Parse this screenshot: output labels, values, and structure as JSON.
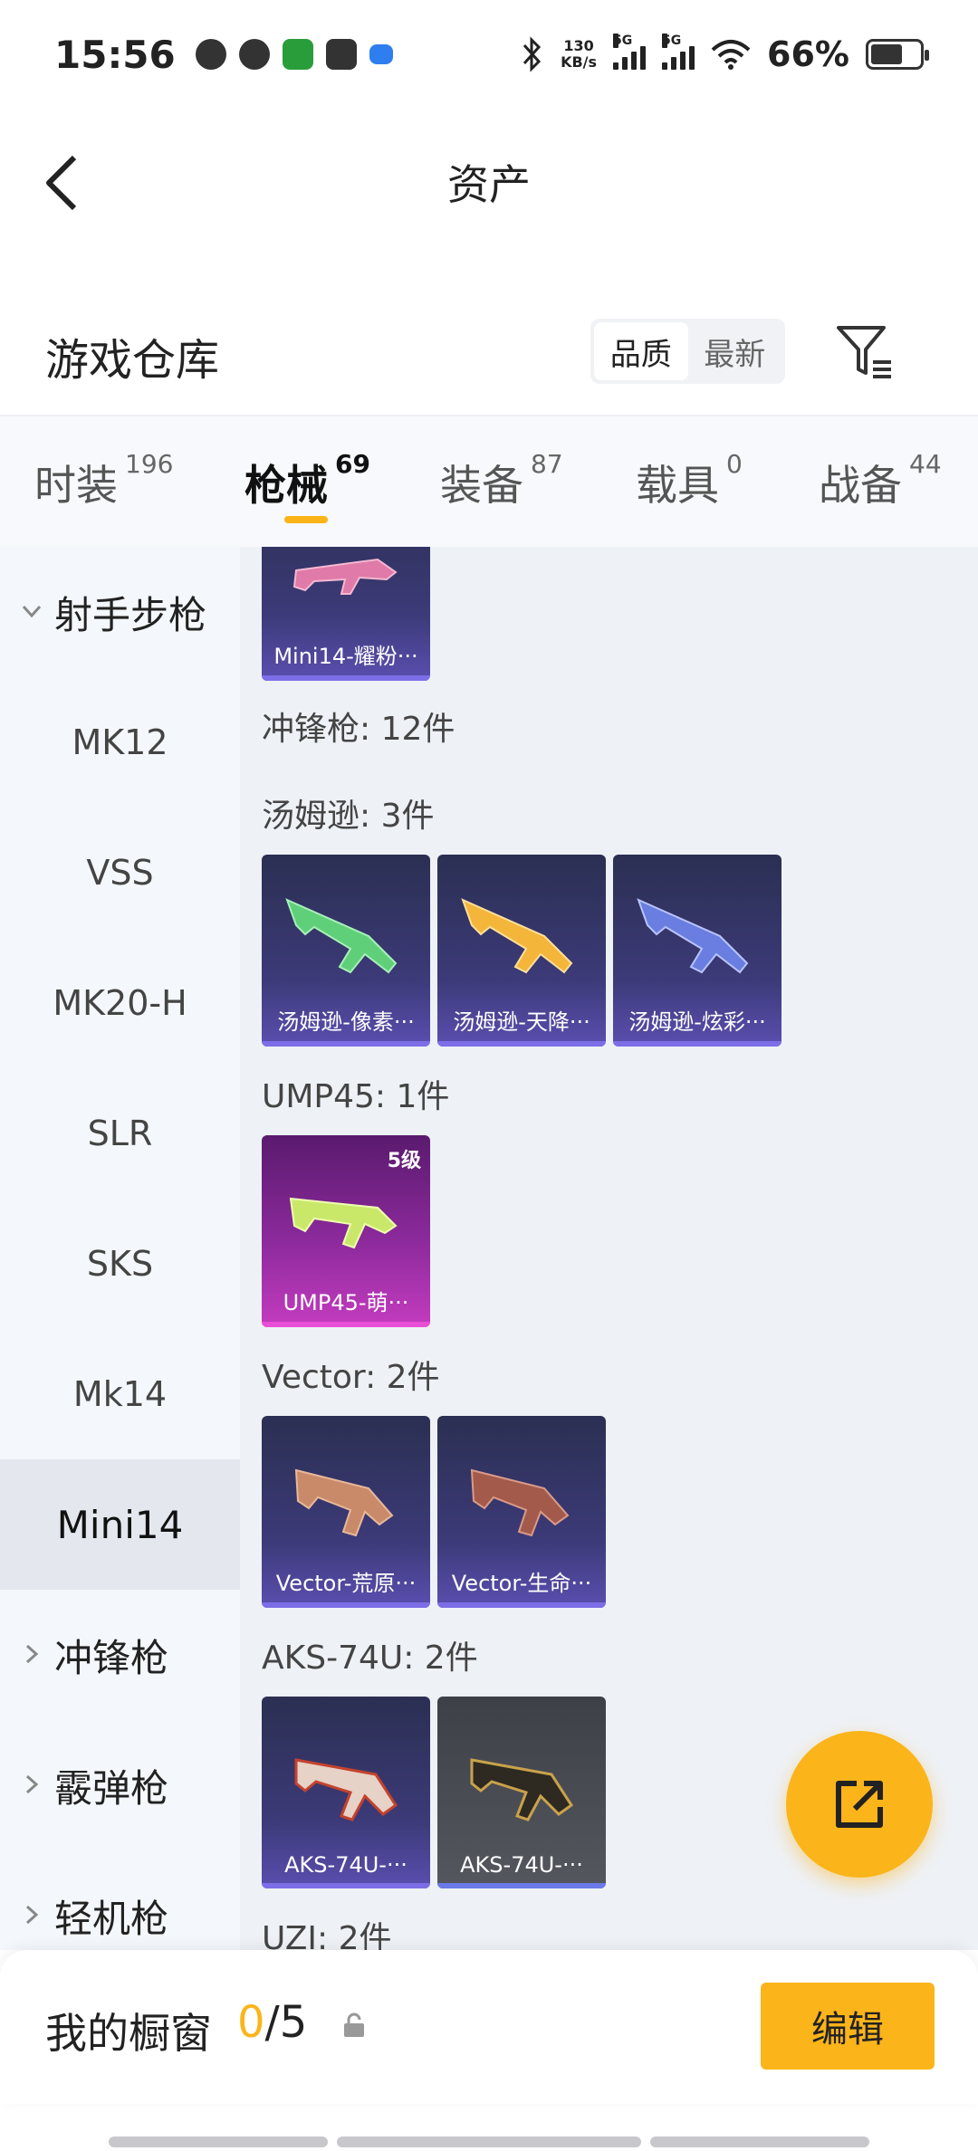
{
  "status_bar": {
    "time": "15:56",
    "speed_top": "130",
    "speed_unit": "KB/s",
    "sig1": "5G",
    "sig2": "5G",
    "battery": "66%"
  },
  "header": {
    "title": "资产"
  },
  "warehouse": {
    "title": "游戏仓库",
    "sort_quality": "品质",
    "sort_latest": "最新"
  },
  "tabs": [
    {
      "label": "时装",
      "count": "196"
    },
    {
      "label": "枪械",
      "count": "69"
    },
    {
      "label": "装备",
      "count": "87"
    },
    {
      "label": "载具",
      "count": "0"
    },
    {
      "label": "战备",
      "count": "44"
    }
  ],
  "sidebar": {
    "group_marksman": "射手步枪",
    "items": [
      "MK12",
      "VSS",
      "MK20-H",
      "SLR",
      "SKS",
      "Mk14",
      "Mini14"
    ],
    "group_smg": "冲锋枪",
    "group_shotgun": "霰弹枪",
    "group_lmg": "轻机枪"
  },
  "content": {
    "top_card_name": "Mini14-耀粉···",
    "smg_label": "冲锋枪: 12件",
    "tommy_label": "汤姆逊: 3件",
    "tommy_cards": [
      "汤姆逊-像素···",
      "汤姆逊-天降···",
      "汤姆逊-炫彩···"
    ],
    "ump_label": "UMP45: 1件",
    "ump_card": "UMP45-萌···",
    "ump_level": "5级",
    "vector_label": "Vector: 2件",
    "vector_cards": [
      "Vector-荒原···",
      "Vector-生命···"
    ],
    "aks_label": "AKS-74U: 2件",
    "aks_cards": [
      "AKS-74U-···",
      "AKS-74U-···"
    ],
    "uzi_label": "UZI: 2件"
  },
  "bottom_bar": {
    "title": "我的橱窗",
    "count_current": "0",
    "count_total": "/5",
    "edit": "编辑"
  },
  "colors": {
    "accent": "#fbb41a",
    "card_purple": "#3c3a78",
    "card_pink": "#8c2a9c"
  }
}
